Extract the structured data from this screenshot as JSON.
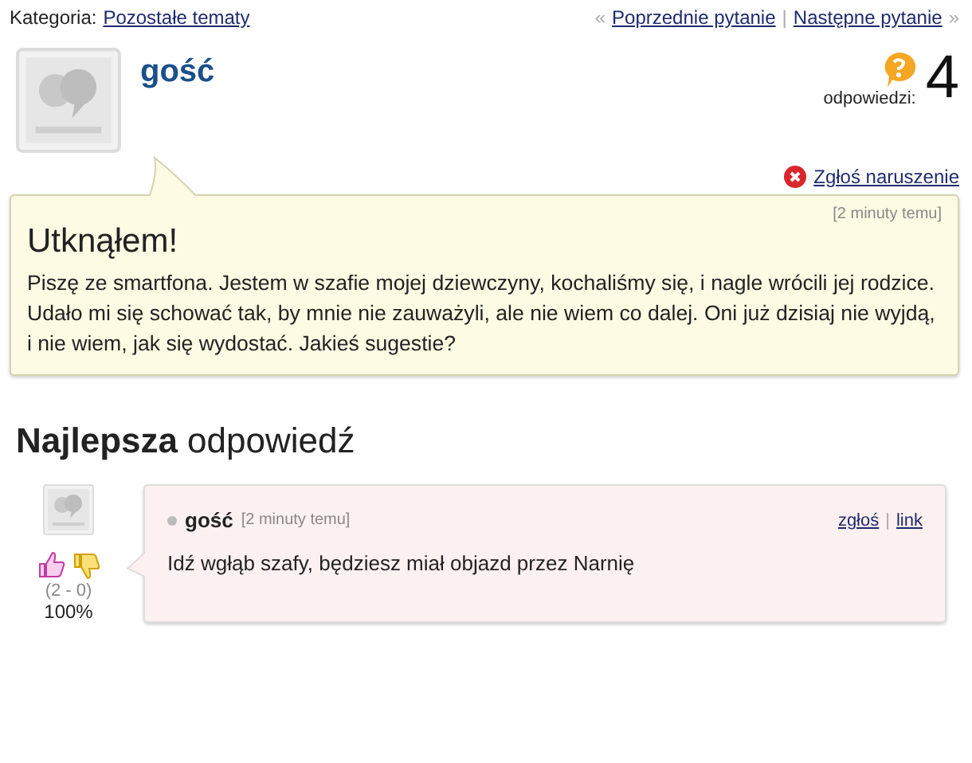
{
  "category": {
    "label": "Kategoria:",
    "link": "Pozostałe tematy"
  },
  "nav": {
    "prev_mark": "«",
    "prev": "Poprzednie pytanie",
    "separator": "|",
    "next": "Następne pytanie",
    "next_mark": "»"
  },
  "question": {
    "author": "gość",
    "answers_label": "odpowiedzi:",
    "answers_count": "4",
    "report": "Zgłoś naruszenie",
    "time": "[2 minuty temu]",
    "title": "Utknąłem!",
    "body": "Piszę ze smartfona. Jestem w szafie mojej dziewczyny, kochaliśmy się, i nagle wrócili jej rodzice. Udało mi się schować tak, by mnie nie zauważyli, ale nie wiem co dalej. Oni już dzisiaj nie wyjdą, i nie wiem, jak się wydostać. Jakieś sugestie?"
  },
  "best_answer": {
    "heading_bold": "Najlepsza",
    "heading_rest": "odpowiedź",
    "votes": "(2 - 0)",
    "percent": "100%",
    "author": "gość",
    "time": "[2 minuty temu]",
    "report": "zgłoś",
    "separator": "|",
    "link": "link",
    "body": "Idź wgłąb szafy, będziesz miał objazd przez Narnię"
  }
}
